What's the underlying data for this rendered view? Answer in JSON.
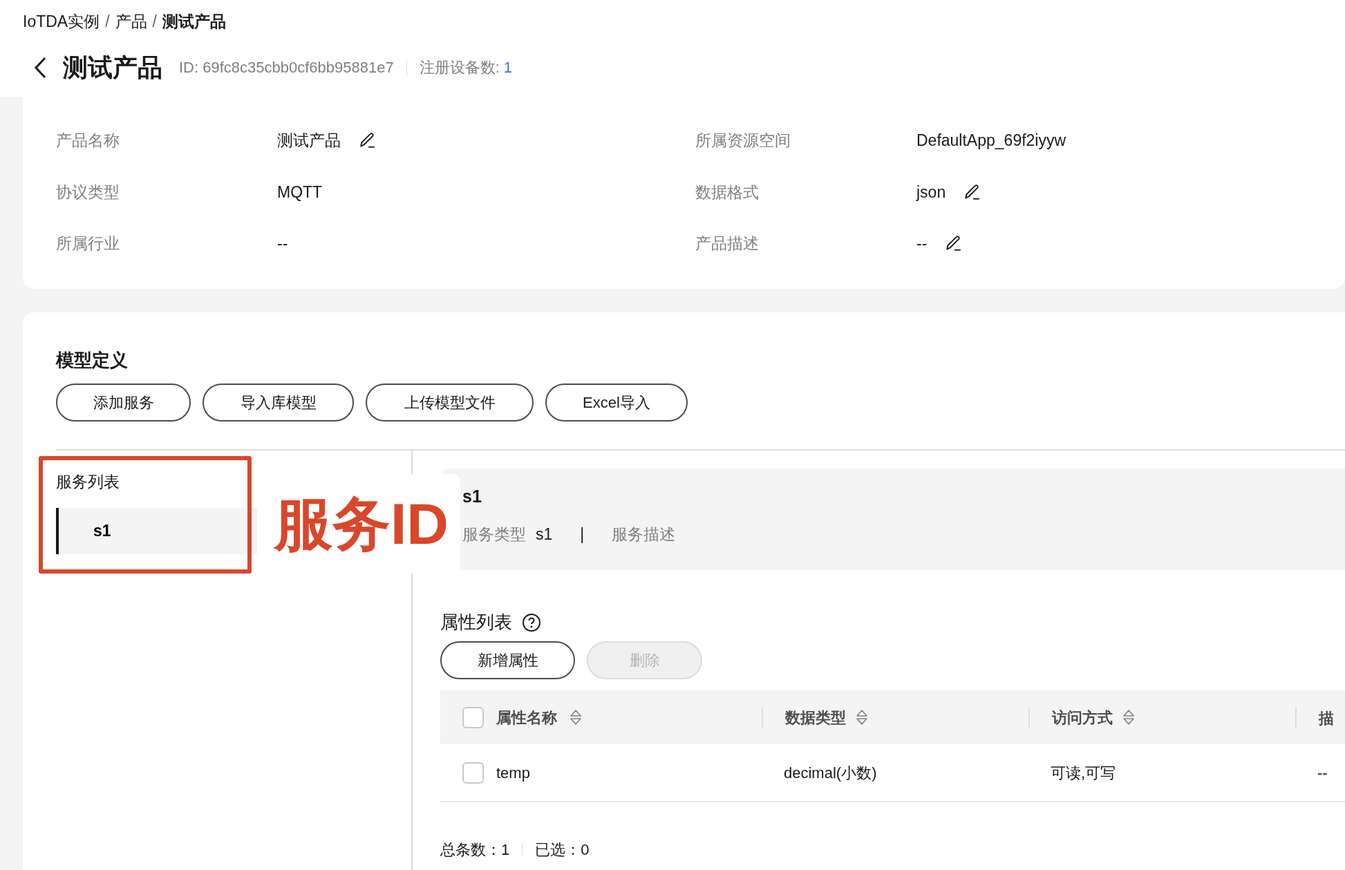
{
  "breadcrumb": [
    {
      "label": "IoTDA实例",
      "current": false
    },
    {
      "separator": "/",
      "label": "产品",
      "current": false
    },
    {
      "separator": "/",
      "label": "测试产品",
      "current": true
    }
  ],
  "header": {
    "title": "测试产品",
    "id_text": "ID: 69fc8c35cbb0cf6bb95881e7",
    "device_count_label": "注册设备数:",
    "device_count": "1"
  },
  "details": [
    {
      "label": "产品名称",
      "value": "测试产品",
      "editable": true
    },
    {
      "label": "所属资源空间",
      "value": "DefaultApp_69f2iyyw",
      "editable": false
    },
    {
      "label": "协议类型",
      "value": "MQTT",
      "editable": false
    },
    {
      "label": "数据格式",
      "value": "json",
      "editable": true
    },
    {
      "label": "所属行业",
      "value": "--",
      "editable": false
    },
    {
      "label": "产品描述",
      "value": "--",
      "editable": true
    }
  ],
  "model": {
    "title": "模型定义",
    "buttons": [
      "添加服务",
      "导入库模型",
      "上传模型文件",
      "Excel导入"
    ],
    "service_list": {
      "title": "服务列表",
      "items": [
        {
          "label": "s1",
          "selected": true
        }
      ]
    },
    "service": {
      "name": "s1",
      "type_label": "服务类型",
      "type_value": "s1",
      "separator": "|",
      "description_label": "服务描述"
    },
    "properties": {
      "title": "属性列表",
      "buttons": [
        {
          "label": "新增属性",
          "disabled": false
        },
        {
          "label": "删除",
          "disabled": true
        }
      ],
      "select_all_checked": false,
      "columns": [
        "属性名称",
        "数据类型",
        "访问方式",
        "描"
      ],
      "rows": [
        {
          "checked": false,
          "cells": [
            "temp",
            "decimal(小数)",
            "可读,可写",
            "--"
          ]
        }
      ],
      "total_label": "总条数：",
      "total": "1",
      "selected_label": "已选：",
      "selected_count": "0"
    }
  },
  "annotation": {
    "label": "服务ID"
  }
}
